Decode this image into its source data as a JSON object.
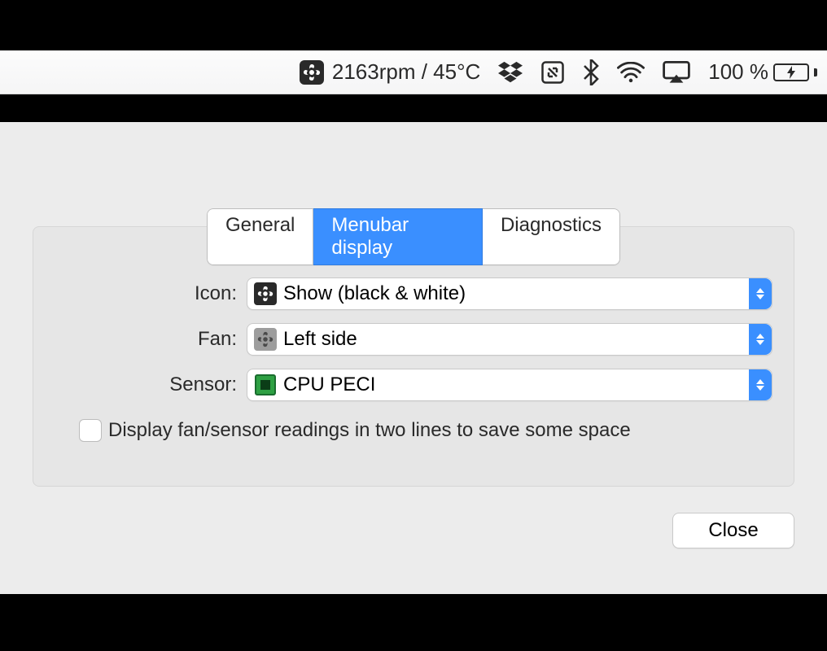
{
  "menubar": {
    "fan_reading": "2163rpm / 45°C",
    "battery_pct": "100 %"
  },
  "tabs": {
    "general": "General",
    "menubar_display": "Menubar display",
    "diagnostics": "Diagnostics"
  },
  "form": {
    "icon_label": "Icon:",
    "icon_value": "Show (black & white)",
    "fan_label": "Fan:",
    "fan_value": "Left side",
    "sensor_label": "Sensor:",
    "sensor_value": "CPU PECI",
    "two_lines_label": "Display fan/sensor readings in two lines to save some space"
  },
  "buttons": {
    "close": "Close"
  }
}
